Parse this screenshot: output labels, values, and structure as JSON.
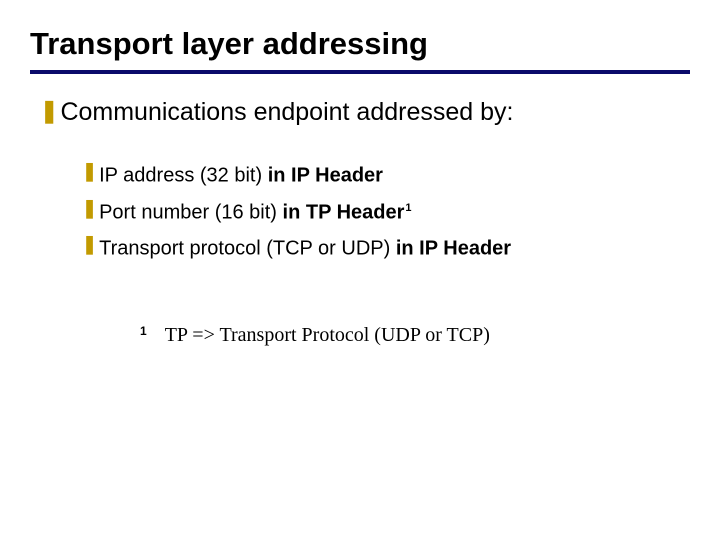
{
  "title": "Transport layer addressing",
  "bullets": {
    "z_glyph": "❚",
    "y_glyph": "❚"
  },
  "main": {
    "text": "Communications endpoint addressed by:"
  },
  "sub": [
    {
      "plain": "IP address (32 bit) ",
      "bold": "in IP Header",
      "sup": ""
    },
    {
      "plain": "Port number (16 bit) ",
      "bold": "in TP Header",
      "sup": "1"
    },
    {
      "plain": "Transport protocol (TCP or UDP) ",
      "bold": "in IP Header",
      "sup": ""
    }
  ],
  "footnote": {
    "num": "1",
    "text": "TP => Transport Protocol (UDP or TCP)"
  }
}
